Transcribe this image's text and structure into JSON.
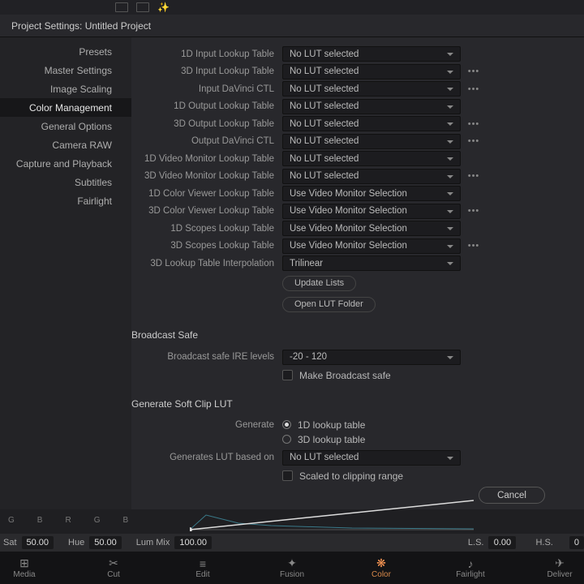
{
  "header": {
    "title": "Project Settings:  Untitled Project"
  },
  "sidebar": {
    "items": [
      {
        "label": "Presets"
      },
      {
        "label": "Master Settings"
      },
      {
        "label": "Image Scaling"
      },
      {
        "label": "Color Management"
      },
      {
        "label": "General Options"
      },
      {
        "label": "Camera RAW"
      },
      {
        "label": "Capture and Playback"
      },
      {
        "label": "Subtitles"
      },
      {
        "label": "Fairlight"
      }
    ],
    "active_index": 3
  },
  "lut_rows": [
    {
      "label": "1D Input Lookup Table",
      "value": "No LUT selected",
      "dots": false
    },
    {
      "label": "3D Input Lookup Table",
      "value": "No LUT selected",
      "dots": true
    },
    {
      "label": "Input DaVinci CTL",
      "value": "No LUT selected",
      "dots": true
    },
    {
      "label": "1D Output Lookup Table",
      "value": "No LUT selected",
      "dots": false
    },
    {
      "label": "3D Output Lookup Table",
      "value": "No LUT selected",
      "dots": true
    },
    {
      "label": "Output DaVinci CTL",
      "value": "No LUT selected",
      "dots": true
    },
    {
      "label": "1D Video Monitor Lookup Table",
      "value": "No LUT selected",
      "dots": false
    },
    {
      "label": "3D Video Monitor Lookup Table",
      "value": "No LUT selected",
      "dots": true
    },
    {
      "label": "1D Color Viewer Lookup Table",
      "value": "Use Video Monitor Selection",
      "dots": false
    },
    {
      "label": "3D Color Viewer Lookup Table",
      "value": "Use Video Monitor Selection",
      "dots": true
    },
    {
      "label": "1D Scopes Lookup Table",
      "value": "Use Video Monitor Selection",
      "dots": false
    },
    {
      "label": "3D Scopes Lookup Table",
      "value": "Use Video Monitor Selection",
      "dots": true
    },
    {
      "label": "3D Lookup Table Interpolation",
      "value": "Trilinear",
      "dots": false
    }
  ],
  "buttons": {
    "update_lists": "Update Lists",
    "open_lut_folder": "Open LUT Folder",
    "cancel": "Cancel"
  },
  "broadcast": {
    "title": "Broadcast Safe",
    "ire_label": "Broadcast safe IRE levels",
    "ire_value": "-20 - 120",
    "checkbox_label": "Make Broadcast safe"
  },
  "softclip": {
    "title": "Generate Soft Clip LUT",
    "generate_label": "Generate",
    "radio1": "1D lookup table",
    "radio2": "3D lookup table",
    "basedon_label": "Generates LUT based on",
    "basedon_value": "No LUT selected",
    "scaled_label": "Scaled to clipping range"
  },
  "params": {
    "sat_label": "Sat",
    "sat_value": "50.00",
    "hue_label": "Hue",
    "hue_value": "50.00",
    "lummix_label": "Lum Mix",
    "lummix_value": "100.00",
    "ls_label": "L.S.",
    "ls_value": "0.00",
    "hs_label": "H.S."
  },
  "nav": {
    "items": [
      {
        "label": "Media",
        "icon": "⊞"
      },
      {
        "label": "Cut",
        "icon": "✂"
      },
      {
        "label": "Edit",
        "icon": "≡"
      },
      {
        "label": "Fusion",
        "icon": "✦"
      },
      {
        "label": "Color",
        "icon": "❋"
      },
      {
        "label": "Fairlight",
        "icon": "♪"
      },
      {
        "label": "Deliver",
        "icon": "✈"
      }
    ],
    "active_index": 4
  },
  "scope_letters": [
    "G",
    "B",
    "R",
    "G",
    "B"
  ]
}
